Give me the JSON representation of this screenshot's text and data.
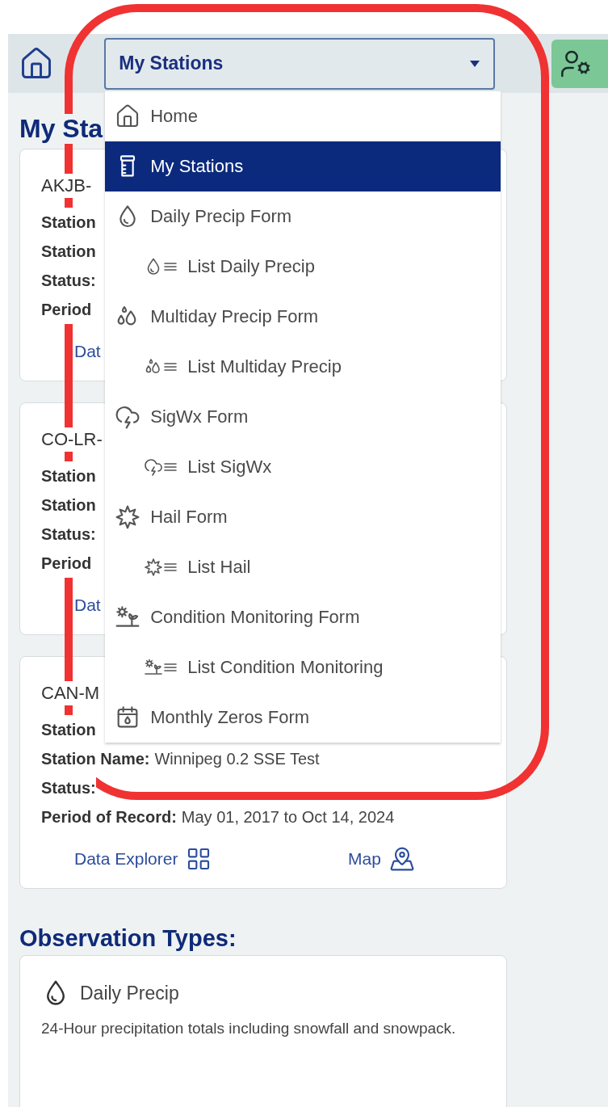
{
  "header": {
    "select": {
      "value": "My Stations"
    }
  },
  "menu": [
    {
      "label": "Home",
      "kind": "home",
      "selected": false
    },
    {
      "label": "My Stations",
      "kind": "stations",
      "selected": true
    },
    {
      "label": "Daily Precip Form",
      "kind": "daily",
      "selected": false,
      "children": [
        {
          "label": "List Daily Precip",
          "kind": "daily",
          "selected": false
        }
      ]
    },
    {
      "label": "Multiday Precip Form",
      "kind": "multiday",
      "selected": false,
      "children": [
        {
          "label": "List Multiday Precip",
          "kind": "multiday",
          "selected": false
        }
      ]
    },
    {
      "label": "SigWx Form",
      "kind": "sigwx",
      "selected": false,
      "children": [
        {
          "label": "List SigWx",
          "kind": "sigwx",
          "selected": false
        }
      ]
    },
    {
      "label": "Hail Form",
      "kind": "hail",
      "selected": false,
      "children": [
        {
          "label": "List Hail",
          "kind": "hail",
          "selected": false
        }
      ]
    },
    {
      "label": "Condition Monitoring Form",
      "kind": "condition",
      "selected": false,
      "children": [
        {
          "label": "List Condition Monitoring",
          "kind": "condition",
          "selected": false
        }
      ]
    },
    {
      "label": "Monthly Zeros Form",
      "kind": "zeros",
      "selected": false
    }
  ],
  "stations_heading": "My Sta",
  "stations": [
    {
      "title": "AKJB-",
      "rows": [
        {
          "label": "Station"
        },
        {
          "label": "Station"
        },
        {
          "label": "Status:"
        },
        {
          "label": "Period"
        }
      ],
      "links": [
        {
          "text": "Dat",
          "kind": "plain"
        }
      ]
    },
    {
      "title": "CO-LR-",
      "rows": [
        {
          "label": "Station"
        },
        {
          "label": "Station"
        },
        {
          "label": "Status:"
        },
        {
          "label": "Period"
        }
      ],
      "links": [
        {
          "text": "Dat",
          "kind": "plain"
        }
      ]
    },
    {
      "title": "CAN-M",
      "rows": [
        {
          "label": "Station"
        },
        {
          "label": "Station Name:",
          "value": "Winnipeg 0.2 SSE Test"
        },
        {
          "label": "Status:"
        },
        {
          "label": "Period of Record:",
          "value": "May 01, 2017 to Oct 14, 2024"
        }
      ],
      "links": [
        {
          "text": "Data Explorer",
          "kind": "explorer"
        },
        {
          "text": "Map",
          "kind": "map"
        }
      ]
    }
  ],
  "observation_heading": "Observation Types:",
  "observation_types": [
    {
      "title": "Daily Precip",
      "kind": "daily",
      "description": "24-Hour precipitation totals including snowfall and snowpack."
    }
  ]
}
